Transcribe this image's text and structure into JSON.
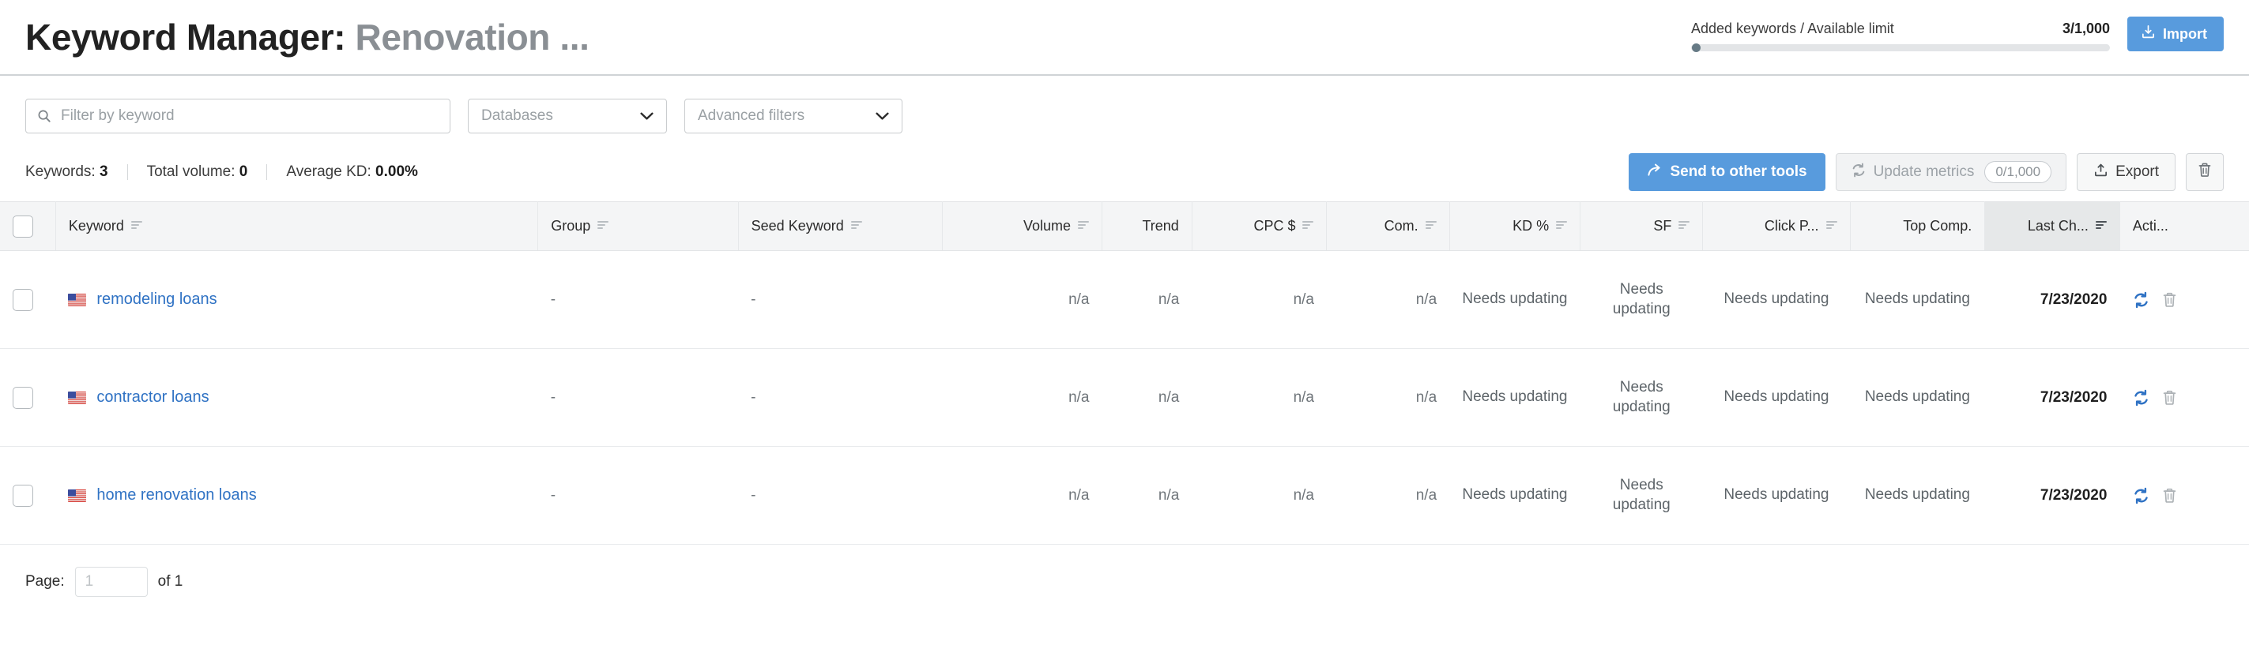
{
  "header": {
    "title_main": "Keyword Manager:",
    "title_sub": "Renovation ...",
    "limit_label": "Added keywords / Available limit",
    "limit_value": "3/1,000",
    "import_label": "Import",
    "import_icon": "download-import-icon",
    "progress_percent": 0.3
  },
  "filters": {
    "search_placeholder": "Filter by keyword",
    "search_value": "",
    "search_icon": "search-icon",
    "databases_label": "Databases",
    "advanced_label": "Advanced filters",
    "chevron_icon": "chevron-down-icon"
  },
  "stats": {
    "keywords_label": "Keywords:",
    "keywords_value": "3",
    "volume_label": "Total volume:",
    "volume_value": "0",
    "kd_label": "Average KD:",
    "kd_value": "0.00%"
  },
  "actions": {
    "send_label": "Send to other tools",
    "send_icon": "share-arrow-icon",
    "update_label": "Update metrics",
    "update_count": "0/1,000",
    "update_icon": "refresh-icon",
    "export_label": "Export",
    "export_icon": "upload-export-icon",
    "delete_icon": "trash-icon"
  },
  "table": {
    "columns": [
      {
        "label": "",
        "key": "check",
        "sortable": false,
        "align": "left"
      },
      {
        "label": "Keyword",
        "key": "keyword",
        "sortable": true,
        "align": "left"
      },
      {
        "label": "Group",
        "key": "group",
        "sortable": true,
        "align": "left"
      },
      {
        "label": "Seed Keyword",
        "key": "seed",
        "sortable": true,
        "align": "left"
      },
      {
        "label": "Volume",
        "key": "volume",
        "sortable": true,
        "align": "right"
      },
      {
        "label": "Trend",
        "key": "trend",
        "sortable": false,
        "align": "right"
      },
      {
        "label": "CPC $",
        "key": "cpc",
        "sortable": true,
        "align": "right"
      },
      {
        "label": "Com.",
        "key": "com",
        "sortable": true,
        "align": "right"
      },
      {
        "label": "KD %",
        "key": "kd",
        "sortable": true,
        "align": "right"
      },
      {
        "label": "SF",
        "key": "sf",
        "sortable": true,
        "align": "right"
      },
      {
        "label": "Click P...",
        "key": "clickp",
        "sortable": true,
        "align": "right"
      },
      {
        "label": "Top Comp.",
        "key": "topcomp",
        "sortable": false,
        "align": "right"
      },
      {
        "label": "Last Ch...",
        "key": "lastch",
        "sortable": true,
        "align": "right",
        "active": true
      },
      {
        "label": "Acti...",
        "key": "actions",
        "sortable": false,
        "align": "left"
      }
    ],
    "rows": [
      {
        "checked": false,
        "flag": "us-flag-icon",
        "keyword": "remodeling loans",
        "group": "-",
        "seed": "-",
        "volume": "n/a",
        "trend": "n/a",
        "cpc": "n/a",
        "com": "n/a",
        "kd": "Needs updating",
        "sf": "Needs updating",
        "clickp": "Needs updating",
        "topcomp": "Needs updating",
        "lastch": "7/23/2020",
        "refresh_icon": "refresh-icon",
        "delete_icon": "trash-icon"
      },
      {
        "checked": false,
        "flag": "us-flag-icon",
        "keyword": "contractor loans",
        "group": "-",
        "seed": "-",
        "volume": "n/a",
        "trend": "n/a",
        "cpc": "n/a",
        "com": "n/a",
        "kd": "Needs updating",
        "sf": "Needs updating",
        "clickp": "Needs updating",
        "topcomp": "Needs updating",
        "lastch": "7/23/2020",
        "refresh_icon": "refresh-icon",
        "delete_icon": "trash-icon"
      },
      {
        "checked": false,
        "flag": "us-flag-icon",
        "keyword": "home renovation loans",
        "group": "-",
        "seed": "-",
        "volume": "n/a",
        "trend": "n/a",
        "cpc": "n/a",
        "com": "n/a",
        "kd": "Needs updating",
        "sf": "Needs updating",
        "clickp": "Needs updating",
        "topcomp": "Needs updating",
        "lastch": "7/23/2020",
        "refresh_icon": "refresh-icon",
        "delete_icon": "trash-icon"
      }
    ]
  },
  "pager": {
    "page_label": "Page:",
    "page_placeholder": "1",
    "page_value": "",
    "of_label": "of 1"
  },
  "colors": {
    "accent_blue": "#589bdd",
    "link_blue": "#2f72c4",
    "icon_blue": "#2f72c4",
    "muted": "#6f757a",
    "header_bg": "#f4f5f6",
    "active_header_bg": "#e6e8e9"
  }
}
